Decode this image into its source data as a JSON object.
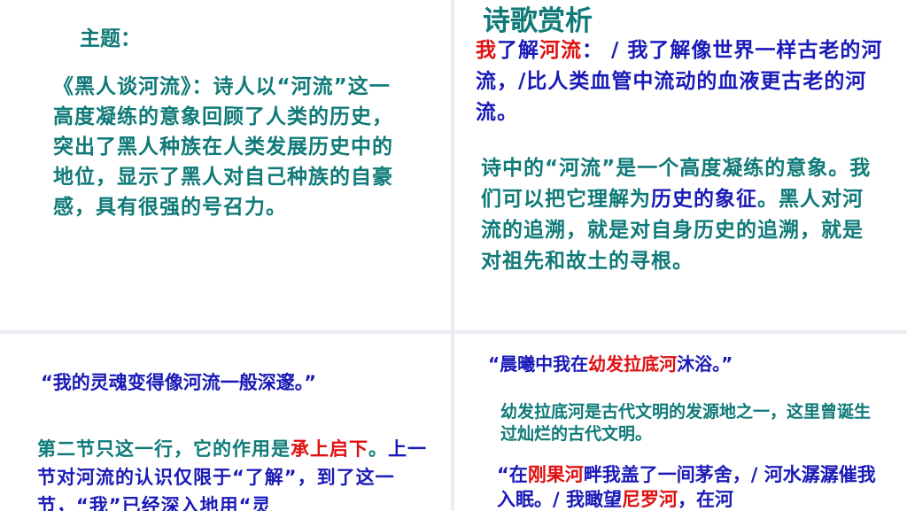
{
  "left_top": {
    "label": "主题：",
    "body": "《黑人谈河流》：诗人以“河流”这一高度凝练的意象回顾了人类的历史，突出了黑人种族在人类发展历史中的地位，显示了黑人对自己种族的自豪感，具有很强的号召力。"
  },
  "right_top": {
    "title": "诗歌赏析",
    "quote": {
      "w1": "我",
      "w2": "了解",
      "w3": "河流",
      "w4": "： / 我了解像世界一样古老的河流，/比人类血管中流动的血液更古老的河流。"
    },
    "analysis": {
      "a1": "诗中的“河流”是一个高度凝练的意象。我们可以把它理解为",
      "a2": "历史的象征",
      "a3": "。黑人对河流的追溯，就是对自身历史的追溯，就是对祖先和故土的寻根。"
    }
  },
  "left_bottom": {
    "quote": "“我的灵魂变得像河流一般深邃。”",
    "note": {
      "n1": "第二节只这一行，它的作用是",
      "n2": "承上启下",
      "n3": "。",
      "n4": "上一节",
      "n5": "对河流的认识仅限于“了解”，到了这一节，“我”已经深入地用“灵"
    }
  },
  "right_bottom": {
    "quote": {
      "q1": "“晨曦中我在",
      "q2": "幼发拉底河",
      "q3": "沐浴。”"
    },
    "note": "幼发拉底河是古代文明的发源地之一，这里曾诞生过灿烂的古代文明。",
    "quote2": {
      "r1": "“在",
      "r2": "刚果河",
      "r3": "畔我盖了一间茅舍，/ 河水潺潺催我入眠。/ 我瞰望",
      "r4": "尼罗河",
      "r5": "，在河"
    }
  }
}
